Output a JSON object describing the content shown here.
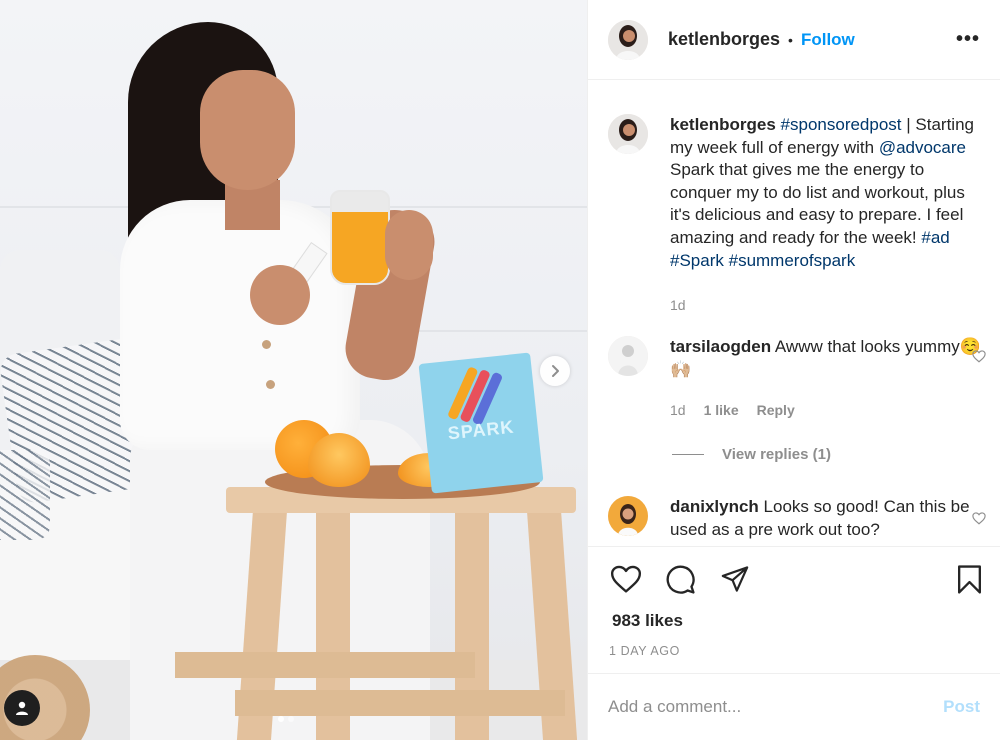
{
  "post": {
    "author": "ketlenborges",
    "follow_label": "Follow",
    "separator": "•",
    "more_label": "•••",
    "caption": {
      "username": "ketlenborges",
      "hashtag_sponsored": "#sponsoredpost",
      "text_1": " | Starting my week full of energy with ",
      "mention": "@advocare",
      "text_2": " Spark that gives me the energy to conquer my to do list and workout, plus it's delicious and easy to prepare. I feel amazing and ready for the week! ",
      "hashtags": [
        "#ad",
        "#Spark",
        "#summerofspark"
      ],
      "time": "1d"
    },
    "comments": [
      {
        "username": "tarsilaogden",
        "text": "Awww that looks yummy",
        "emoji": "☺️🙌🏼",
        "time": "1d",
        "likes": "1 like",
        "reply_label": "Reply",
        "view_replies": "View replies (1)"
      },
      {
        "username": "danixlynch",
        "text": "Looks so good! Can this be used as a pre work out too?"
      }
    ],
    "likes": "983 likes",
    "date": "1 DAY AGO",
    "comment_placeholder": "Add a comment...",
    "post_label": "Post",
    "photo": {
      "product_text": "SPARK",
      "carousel_total": 2,
      "carousel_active": 1
    }
  },
  "icons": {
    "like": "heart-icon",
    "comment": "comment-icon",
    "share": "paper-plane-icon",
    "save": "bookmark-icon",
    "next": "chevron-right-icon",
    "tags": "user-tag-icon"
  },
  "colors": {
    "link": "#0095f6",
    "tag": "#00376b",
    "muted": "#8e8e8e",
    "post_disabled": "#b2dffc"
  }
}
